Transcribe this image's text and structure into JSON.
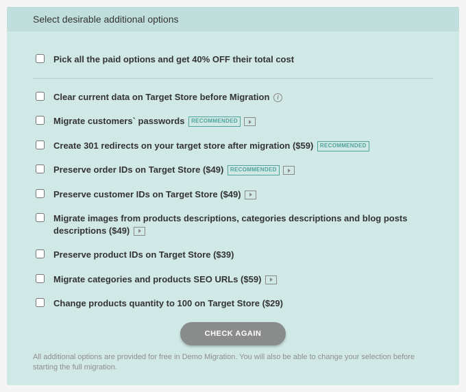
{
  "header": {
    "title": "Select desirable additional options"
  },
  "pick_all": {
    "label": "Pick all the paid options and get 40% OFF their total cost"
  },
  "options": [
    {
      "label": "Clear current data on Target Store before Migration",
      "info": true,
      "video": false,
      "recommended": false
    },
    {
      "label": "Migrate customers` passwords",
      "info": false,
      "video": true,
      "recommended": true
    },
    {
      "label": "Create 301 redirects on your target store after migration ($59)",
      "info": false,
      "video": false,
      "recommended": true
    },
    {
      "label": "Preserve order IDs on Target Store ($49)",
      "info": false,
      "video": true,
      "recommended": true
    },
    {
      "label": "Preserve customer IDs on Target Store ($49)",
      "info": false,
      "video": true,
      "recommended": false
    },
    {
      "label": "Migrate images from products descriptions, categories descriptions and blog posts descriptions ($49)",
      "info": false,
      "video": true,
      "recommended": false
    },
    {
      "label": "Preserve product IDs on Target Store ($39)",
      "info": false,
      "video": false,
      "recommended": false
    },
    {
      "label": "Migrate categories and products SEO URLs ($59)",
      "info": false,
      "video": true,
      "recommended": false
    },
    {
      "label": "Change products quantity to 100 on Target Store ($29)",
      "info": false,
      "video": false,
      "recommended": false
    }
  ],
  "badges": {
    "recommended": "RECOMMENDED"
  },
  "button": {
    "check_again": "CHECK AGAIN"
  },
  "footnote": "All additional options are provided for free in Demo Migration. You will also be able to change your selection before starting the full migration."
}
